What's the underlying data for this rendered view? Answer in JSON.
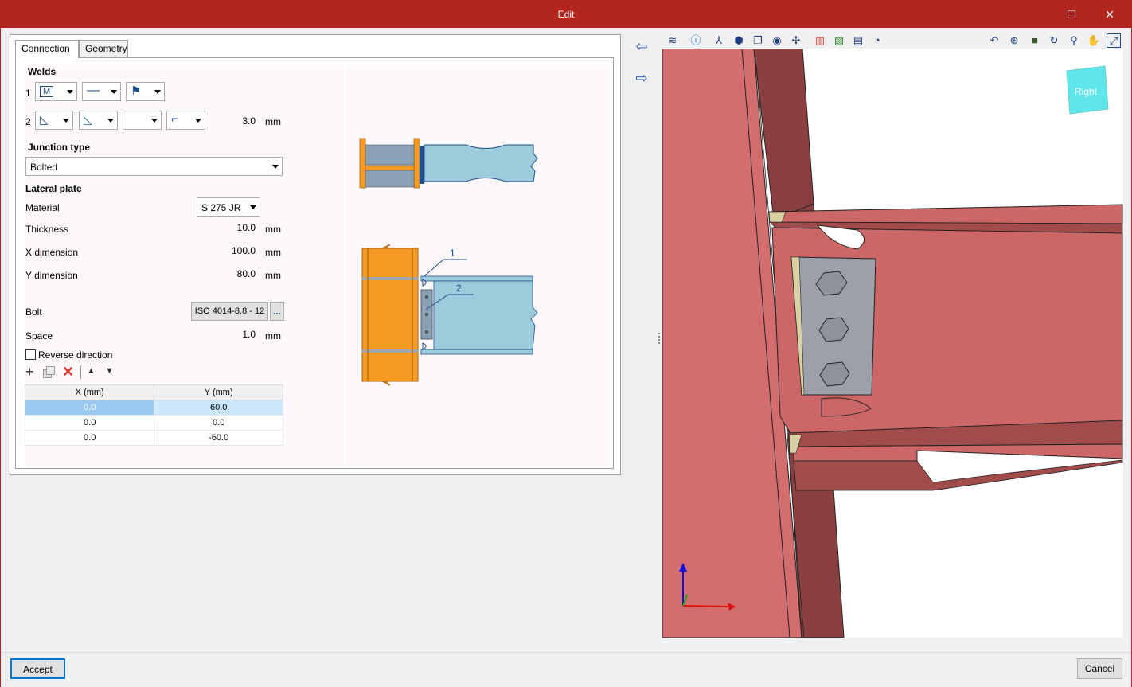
{
  "window": {
    "title": "Edit",
    "maximize_glyph": "☐",
    "close_glyph": "✕"
  },
  "tabs": [
    {
      "label": "Connection"
    },
    {
      "label": "Geometry"
    }
  ],
  "welds": {
    "heading": "Welds",
    "row1_label": "1",
    "row2_label": "2",
    "size_value": "3.0",
    "size_unit": "mm"
  },
  "junction": {
    "heading": "Junction type",
    "selected": "Bolted"
  },
  "lateral_plate": {
    "heading": "Lateral plate",
    "material_label": "Material",
    "material_value": "S 275 JR",
    "thickness_label": "Thickness",
    "thickness_value": "10.0",
    "x_label": "X dimension",
    "x_value": "100.0",
    "y_label": "Y dimension",
    "y_value": "80.0",
    "unit": "mm"
  },
  "bolt": {
    "label": "Bolt",
    "value": "ISO 4014-8.8 - 12",
    "browse_label": "..."
  },
  "space": {
    "label": "Space",
    "value": "1.0",
    "unit": "mm"
  },
  "reverse": {
    "label": "Reverse direction",
    "checked": false
  },
  "table": {
    "columns": [
      "X (mm)",
      "Y (mm)"
    ],
    "rows": [
      [
        "0.0",
        "60.0"
      ],
      [
        "0.0",
        "0.0"
      ],
      [
        "0.0",
        "-60.0"
      ]
    ]
  },
  "diagram": {
    "callout_1": "1",
    "callout_2": "2"
  },
  "view": {
    "cube_face": "Right"
  },
  "buttons": {
    "accept": "Accept",
    "cancel": "Cancel"
  },
  "colors": {
    "title_bar": "#b2261d",
    "steel_3d": "#cd6767",
    "beam_diagram": "#9ccbdc",
    "column_diagram": "#f59a23"
  }
}
